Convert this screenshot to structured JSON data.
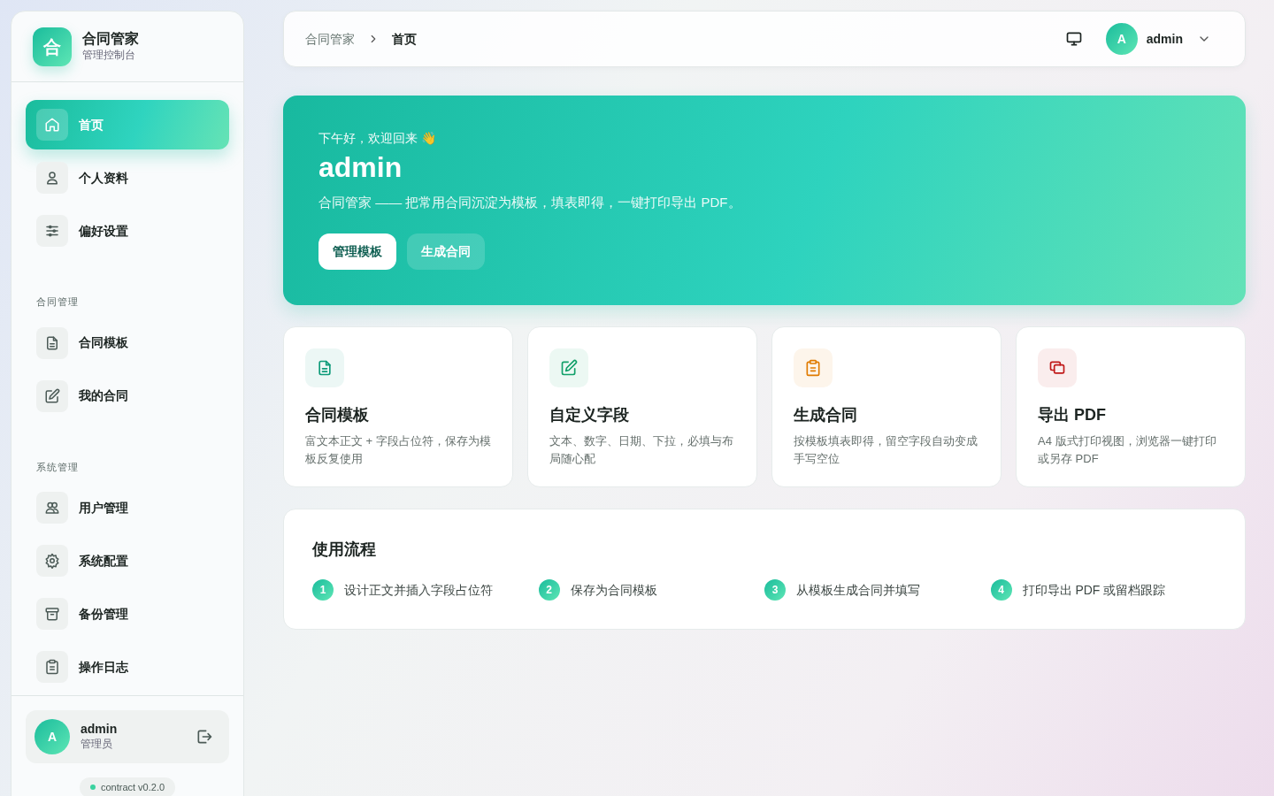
{
  "brand": {
    "logo": "合",
    "title": "合同管家",
    "subtitle": "管理控制台"
  },
  "nav_groups": [
    {
      "items": [
        {
          "label": "首页",
          "kind": "home",
          "selected": true
        },
        {
          "label": "个人资料",
          "kind": "user",
          "selected": false
        },
        {
          "label": "偏好设置",
          "kind": "sliders",
          "selected": false
        }
      ]
    },
    {
      "heading": "合同管理",
      "items": [
        {
          "label": "合同模板",
          "kind": "file",
          "selected": false
        },
        {
          "label": "我的合同",
          "kind": "edit",
          "selected": false
        }
      ]
    },
    {
      "heading": "系统管理",
      "items": [
        {
          "label": "用户管理",
          "kind": "users",
          "selected": false
        },
        {
          "label": "系统配置",
          "kind": "gear",
          "selected": false
        },
        {
          "label": "备份管理",
          "kind": "archive",
          "selected": false
        },
        {
          "label": "操作日志",
          "kind": "clipboard",
          "selected": false
        }
      ]
    }
  ],
  "user_card": {
    "avatar": "A",
    "name": "admin",
    "role": "管理员"
  },
  "version": "contract v0.2.0",
  "topbar": {
    "breadcrumb": [
      {
        "label": "合同管家",
        "selected": false
      },
      {
        "label": "首页",
        "selected": true
      }
    ],
    "user": {
      "avatar": "A",
      "name": "admin"
    }
  },
  "hero": {
    "greeting": "下午好，欢迎回来 👋",
    "name": "admin",
    "tagline": "合同管家 —— 把常用合同沉淀为模板，填表即得，一键打印导出 PDF。",
    "buttons": [
      {
        "label": "管理模板",
        "kind": "primary"
      },
      {
        "label": "生成合同",
        "kind": "secondary"
      }
    ]
  },
  "features": [
    {
      "kind": "file",
      "color": "#0f9b7a",
      "title": "合同模板",
      "text": "富文本正文 + 字段占位符，保存为模板反复使用"
    },
    {
      "kind": "edit",
      "color": "#12a06a",
      "title": "自定义字段",
      "text": "文本、数字、日期、下拉，必填与布局随心配"
    },
    {
      "kind": "clipboard",
      "color": "#e07b00",
      "title": "生成合同",
      "text": "按模板填表即得，留空字段自动变成手写空位"
    },
    {
      "kind": "copy",
      "color": "#c01818",
      "title": "导出 PDF",
      "text": "A4 版式打印视图，浏览器一键打印或另存 PDF"
    }
  ],
  "workflow": {
    "title": "使用流程",
    "steps": [
      {
        "number": "1",
        "text": "设计正文并插入字段占位符"
      },
      {
        "number": "2",
        "text": "保存为合同模板"
      },
      {
        "number": "3",
        "text": "从模板生成合同并填写"
      },
      {
        "number": "4",
        "text": "打印导出 PDF 或留档跟踪"
      }
    ]
  }
}
